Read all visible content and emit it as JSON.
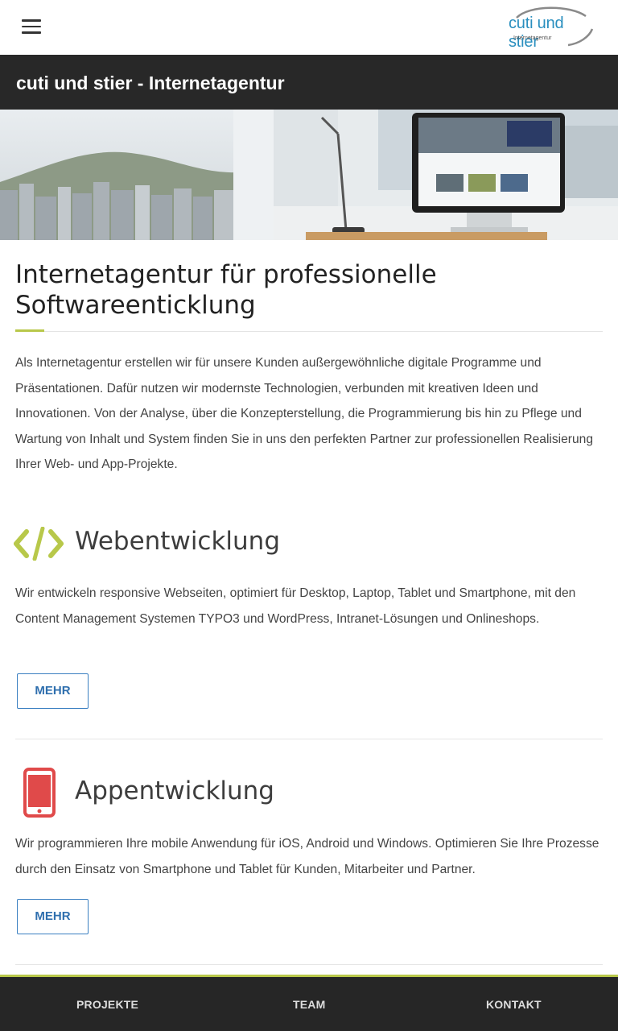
{
  "header": {
    "logo": {
      "main": "cuti und stier",
      "sub": "Internetagentur"
    }
  },
  "title_bar": {
    "title": "cuti und stier - Internetagentur"
  },
  "main": {
    "headline": "Internetagentur für professionelle Softwareenticklung",
    "intro": "Als Internetagentur erstellen wir für unsere Kunden außergewöhnliche digitale Programme und Präsentationen. Dafür nutzen wir modernste Technologien, verbunden mit kreativen Ideen und Innovationen. Von der Analyse, über die Konzepterstellung, die Programmierung bis hin zu Pflege und Wartung von Inhalt und System finden Sie in uns den perfekten Partner zur professionellen Realisierung Ihrer Web- und App-Projekte.",
    "services": [
      {
        "icon": "code-icon",
        "title": "Webentwicklung",
        "text": "Wir entwickeln responsive Webseiten, optimiert für Desktop, Laptop, Tablet und Smartphone, mit den Content Management Systemen TYPO3 und WordPress, Intranet-Lösungen und Onlineshops.",
        "button": "MEHR"
      },
      {
        "icon": "smartphone-icon",
        "title": "Appentwicklung",
        "text": "Wir programmieren Ihre mobile Anwendung für iOS, Android und Windows. Optimieren Sie Ihre Prozesse durch den Einsatz von Smartphone und Tablet für Kunden, Mitarbeiter und Partner.",
        "button": "MEHR"
      }
    ]
  },
  "bottom_nav": {
    "items": [
      "PROJEKTE",
      "TEAM",
      "KONTAKT"
    ]
  },
  "colors": {
    "accent_green": "#b8c84a",
    "dark_bar": "#282828",
    "button_blue": "#3a7fc1",
    "app_icon_red": "#e04a4a",
    "logo_blue": "#2a8fbf"
  }
}
